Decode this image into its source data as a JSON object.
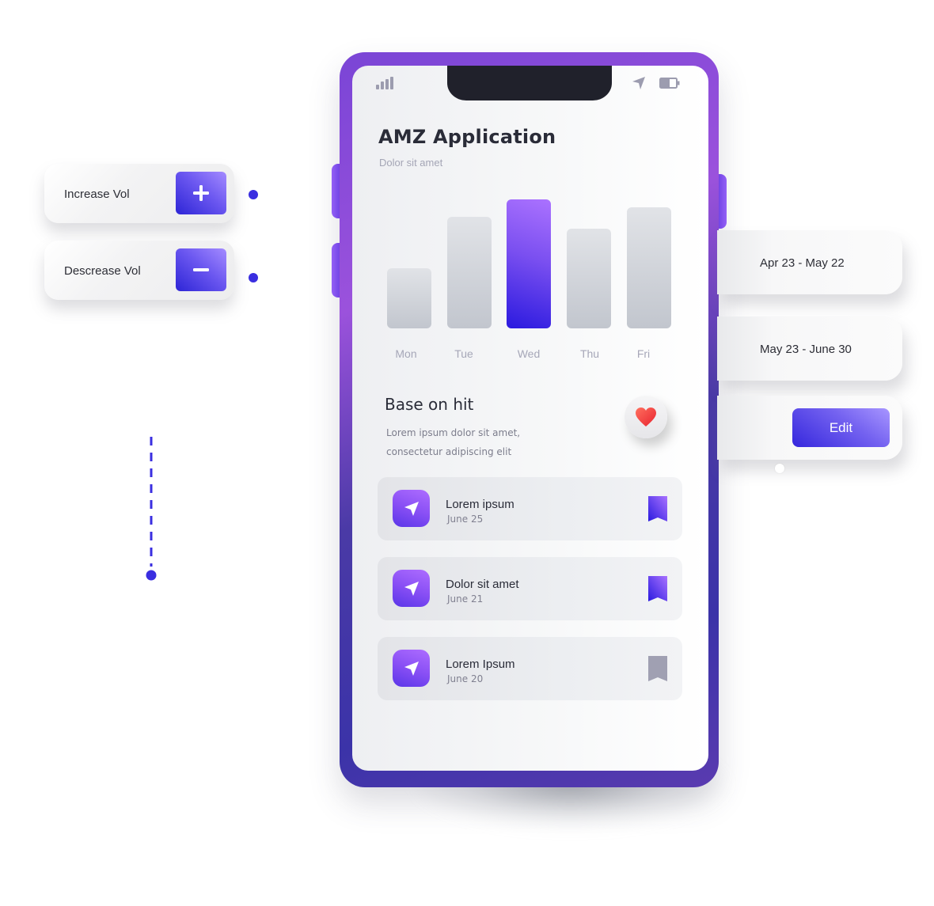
{
  "app": {
    "title": "AMZ Application",
    "subtitle": "Dolor sit amet"
  },
  "status_bar": {
    "icons": [
      "signal-icon",
      "location-arrow-icon",
      "battery-icon"
    ]
  },
  "chart_data": {
    "type": "bar",
    "categories": [
      "Mon",
      "Tue",
      "Wed",
      "Thu",
      "Fri"
    ],
    "values": [
      46,
      85,
      98,
      76,
      92
    ],
    "highlighted": "Wed",
    "ylim": [
      0,
      100
    ],
    "title": "",
    "xlabel": "",
    "ylabel": "",
    "grid": false,
    "colors": {
      "default": "#c9ccd3",
      "highlight": "#6a3ff0"
    }
  },
  "section": {
    "title": "Base on hit",
    "desc_line1": "Lorem ipsum dolor sit amet,",
    "desc_line2": "consectetur adipiscing elit",
    "heart_icon": "heart-icon"
  },
  "list": [
    {
      "title": "Lorem ipsum",
      "date": "June 25",
      "bookmarked": true,
      "bookmark_color": "#6a3ff0"
    },
    {
      "title": "Dolor sit amet",
      "date": "June 21",
      "bookmarked": true,
      "bookmark_color": "#7a4ff0"
    },
    {
      "title": "Lorem Ipsum",
      "date": "June 20",
      "bookmarked": false,
      "bookmark_color": "#a0a0b2"
    }
  ],
  "controls": {
    "increase_label": "Increase Vol",
    "increase_icon": "+",
    "decrease_label": "Descrease Vol",
    "decrease_icon": "−"
  },
  "date_ranges": {
    "first": "Apr 23 - May 22",
    "second": "May 23 - June 30",
    "edit_label": "Edit"
  },
  "colors": {
    "accent": "#3a2ee0",
    "accent_light": "#a78bff",
    "phone_frame": "#4a3aa6",
    "text_dark": "#2a2c38",
    "text_muted": "#a4a5b5"
  }
}
